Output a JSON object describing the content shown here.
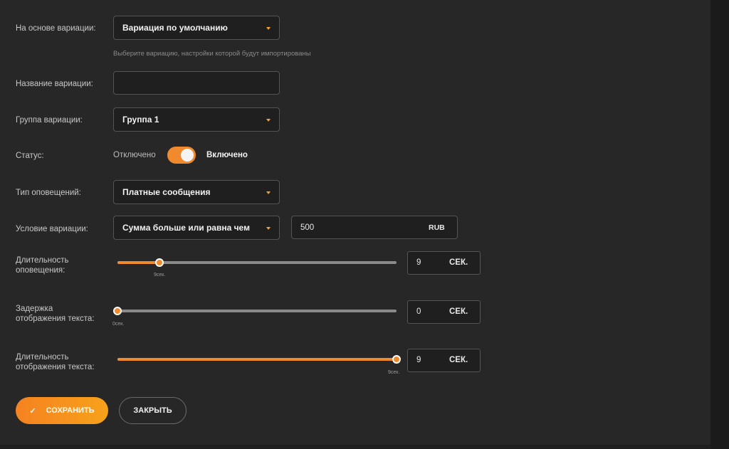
{
  "form": {
    "base_variation": {
      "label": "На основе вариации:",
      "value": "Вариация по умолчанию",
      "hint": "Выберите вариацию, настройки которой будут импортированы"
    },
    "variation_name": {
      "label": "Название вариации:",
      "value": "",
      "placeholder": ""
    },
    "variation_group": {
      "label": "Группа вариации:",
      "value": "Группа 1"
    },
    "status": {
      "label": "Статус:",
      "off_label": "Отключено",
      "on_label": "Включено",
      "enabled": true
    },
    "alert_type": {
      "label": "Тип оповещений:",
      "value": "Платные сообщения"
    },
    "condition": {
      "label": "Условие вариации:",
      "value": "Сумма больше или равна чем",
      "amount": "500",
      "currency": "RUB"
    },
    "alert_duration": {
      "label_line1": "Длительность",
      "label_line2": "оповещения:",
      "value": "9",
      "unit": "СЕК.",
      "tip": "9сек.",
      "fraction": 0.15
    },
    "text_delay": {
      "label_line1": "Задержка",
      "label_line2": "отображения текста:",
      "value": "0",
      "unit": "СЕК.",
      "tip": "0сек.",
      "fraction": 0
    },
    "text_duration": {
      "label_line1": "Длительность",
      "label_line2": "отображения текста:",
      "value": "9",
      "unit": "СЕК.",
      "tip": "9сек.",
      "fraction": 1
    }
  },
  "actions": {
    "save_label": "СОХРАНИТЬ",
    "close_label": "ЗАКРЫТЬ"
  },
  "colors": {
    "accent": "#f08a2c",
    "background": "#272727",
    "field_bg": "#1f1f1f"
  }
}
